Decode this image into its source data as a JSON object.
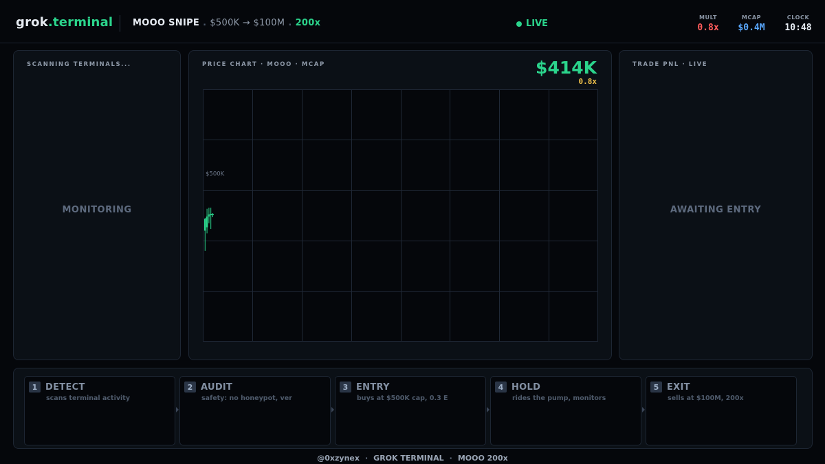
{
  "header": {
    "brand_prefix": "grok",
    "brand_suffix": ".terminal",
    "title": "MOOO SNIPE",
    "range": "$500K → $100M",
    "multiplier": "200x",
    "live_label": "LIVE",
    "stats": {
      "mult": {
        "label": "MULT",
        "value": "0.8x"
      },
      "mcap": {
        "label": "MCAP",
        "value": "$0.4M"
      },
      "clock": {
        "label": "CLOCK",
        "value": "10:48"
      }
    }
  },
  "panels": {
    "scanner": {
      "title": "SCANNING TERMINALS...",
      "status": "MONITORING"
    },
    "chart": {
      "title": "PRICE CHART · MOOO · MCAP",
      "price": "$414K",
      "mult": "0.8x",
      "level_label": "$500K"
    },
    "pnl": {
      "title": "TRADE PNL · LIVE",
      "status": "AWAITING ENTRY"
    }
  },
  "colors": {
    "accent": "#2bd48c",
    "mult": "#ff5c5c",
    "mcap": "#5aa9ff",
    "warn": "#f0c14b"
  },
  "pipeline": [
    {
      "num": "1",
      "name": "DETECT",
      "desc": "scans terminal activity"
    },
    {
      "num": "2",
      "name": "AUDIT",
      "desc": "safety: no honeypot, ver"
    },
    {
      "num": "3",
      "name": "ENTRY",
      "desc": "buys at $500K cap, 0.3 E"
    },
    {
      "num": "4",
      "name": "HOLD",
      "desc": "rides the pump, monitors"
    },
    {
      "num": "5",
      "name": "EXIT",
      "desc": "sells at $100M, 200x"
    }
  ],
  "footer": {
    "handle": "@0xzynex",
    "app": "GROK TERMINAL",
    "tag": "MOOO 200x"
  },
  "chart_data": {
    "type": "candlestick",
    "unit": "$K",
    "grid": true,
    "ylim": [
      0,
      750
    ],
    "reference_line": {
      "label": "$500K",
      "value": 500
    },
    "candles": [
      {
        "open": 365,
        "close": 330,
        "high": 368,
        "low": 270,
        "color": "#2bd48c"
      },
      {
        "open": 340,
        "close": 372,
        "high": 395,
        "low": 322,
        "color": "#2bd48c"
      },
      {
        "open": 372,
        "close": 378,
        "high": 398,
        "low": 352,
        "color": "#2bd48c"
      },
      {
        "open": 376,
        "close": 380,
        "high": 398,
        "low": 335,
        "color": "#2bd48c"
      },
      {
        "open": 378,
        "close": 380,
        "high": 382,
        "low": 370,
        "color": "#2bd48c"
      }
    ]
  }
}
